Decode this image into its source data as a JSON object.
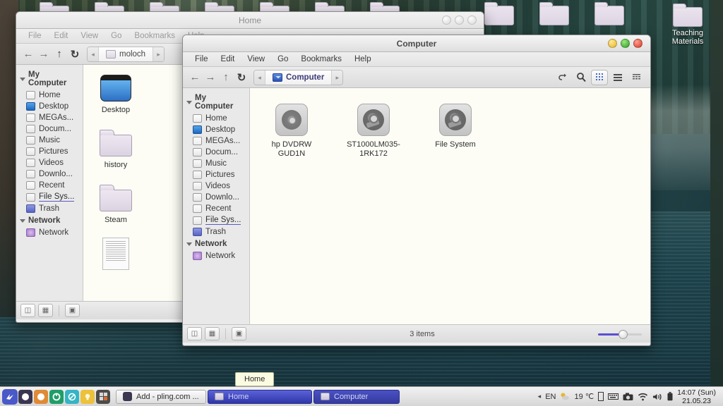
{
  "desktop": {
    "icons": [
      {
        "name": "Teaching\nMaterials",
        "label_line1": "Teaching",
        "label_line2": "Materials"
      }
    ]
  },
  "tooltip": {
    "text": "Home"
  },
  "windows": {
    "home": {
      "title": "Home",
      "menus": [
        "File",
        "Edit",
        "View",
        "Go",
        "Bookmarks",
        "Help"
      ],
      "breadcrumb": {
        "label": "moloch",
        "left_arrow": "◂",
        "right_arrow": "▸"
      },
      "nav": {
        "back": "←",
        "forward": "→",
        "up": "↑",
        "reload": "↻"
      },
      "sidebar": {
        "groups": [
          {
            "label": "My Computer",
            "items": [
              {
                "label": "Home",
                "icon": "home-icon"
              },
              {
                "label": "Desktop",
                "icon": "desktop-icon"
              },
              {
                "label": "MEGAs...",
                "icon": "folder-icon"
              },
              {
                "label": "Docum...",
                "icon": "documents-icon"
              },
              {
                "label": "Music",
                "icon": "music-icon"
              },
              {
                "label": "Pictures",
                "icon": "pictures-icon"
              },
              {
                "label": "Videos",
                "icon": "videos-icon"
              },
              {
                "label": "Downlo...",
                "icon": "downloads-icon"
              },
              {
                "label": "Recent",
                "icon": "recent-icon"
              },
              {
                "label": "File Sys...",
                "icon": "filesystem-icon"
              },
              {
                "label": "Trash",
                "icon": "trash-icon"
              }
            ]
          },
          {
            "label": "Network",
            "items": [
              {
                "label": "Network",
                "icon": "network-icon"
              }
            ]
          }
        ]
      },
      "files": [
        {
          "label": "Desktop",
          "type": "desktop"
        },
        {
          "label": "history",
          "type": "folder"
        },
        {
          "label": "Steam",
          "type": "folder"
        },
        {
          "label": "",
          "type": "document"
        }
      ]
    },
    "computer": {
      "title": "Computer",
      "menus": [
        "File",
        "Edit",
        "View",
        "Go",
        "Bookmarks",
        "Help"
      ],
      "breadcrumb": {
        "label": "Computer",
        "left_arrow": "◂",
        "right_arrow": "▸"
      },
      "nav": {
        "back": "←",
        "forward": "→",
        "up": "↑",
        "reload": "↻"
      },
      "toolbar_icons": [
        "undo-icon",
        "search-icon",
        "icon-view-icon",
        "list-view-icon",
        "compact-view-icon"
      ],
      "sidebar": {
        "groups": [
          {
            "label": "My Computer",
            "items": [
              {
                "label": "Home",
                "icon": "home-icon"
              },
              {
                "label": "Desktop",
                "icon": "desktop-icon"
              },
              {
                "label": "MEGAs...",
                "icon": "folder-icon"
              },
              {
                "label": "Docum...",
                "icon": "documents-icon"
              },
              {
                "label": "Music",
                "icon": "music-icon"
              },
              {
                "label": "Pictures",
                "icon": "pictures-icon"
              },
              {
                "label": "Videos",
                "icon": "videos-icon"
              },
              {
                "label": "Downlo...",
                "icon": "downloads-icon"
              },
              {
                "label": "Recent",
                "icon": "recent-icon"
              },
              {
                "label": "File Sys...",
                "icon": "filesystem-icon"
              },
              {
                "label": "Trash",
                "icon": "trash-icon"
              }
            ]
          },
          {
            "label": "Network",
            "items": [
              {
                "label": "Network",
                "icon": "network-icon"
              }
            ]
          }
        ]
      },
      "drives": [
        {
          "line1": "hp     DVDRW",
          "line2": "GUD1N",
          "type": "optical"
        },
        {
          "line1": "ST1000LM035-",
          "line2": "1RK172",
          "type": "harddisk"
        },
        {
          "line1": "File System",
          "line2": "",
          "type": "harddisk"
        }
      ],
      "status": {
        "items_text": "3 items",
        "zoom_percent": 50
      },
      "window_controls": {
        "minimize": "minimize",
        "maximize": "maximize",
        "close": "close"
      }
    }
  },
  "taskbar": {
    "launchers": [
      {
        "name": "menu-launcher",
        "color": "#4a59c8",
        "glyph": "↗"
      },
      {
        "name": "browser-dark-launcher",
        "color": "#3a3550",
        "glyph": "◖"
      },
      {
        "name": "browser-orange-launcher",
        "color": "#e08a35",
        "glyph": "◖"
      },
      {
        "name": "app-green-launcher",
        "color": "#1f9e68",
        "glyph": "◔"
      },
      {
        "name": "app-teal-launcher",
        "color": "#35b5c4",
        "glyph": "◑"
      },
      {
        "name": "ideas-launcher",
        "color": "#ecc13c",
        "glyph": "●"
      },
      {
        "name": "calculator-launcher",
        "color": "#4c4c4c",
        "glyph": "⊞"
      }
    ],
    "windows": [
      {
        "label": "Add - pling.com ...",
        "state": "normal",
        "icon": "app-icon"
      },
      {
        "label": "Home",
        "state": "active",
        "icon": "folder-icon"
      },
      {
        "label": "Computer",
        "state": "active2",
        "icon": "folder-icon"
      }
    ],
    "tray": {
      "expand_arrow": "◂",
      "language": "EN",
      "weather_icon": "weather-icon",
      "temperature": "19 ℃",
      "icons": [
        "device-icon",
        "keyboard-icon",
        "camera-icon",
        "wifi-icon",
        "volume-icon",
        "battery-icon"
      ],
      "clock_time": "14:07 (Sun)",
      "clock_date": "21.05.23"
    }
  }
}
